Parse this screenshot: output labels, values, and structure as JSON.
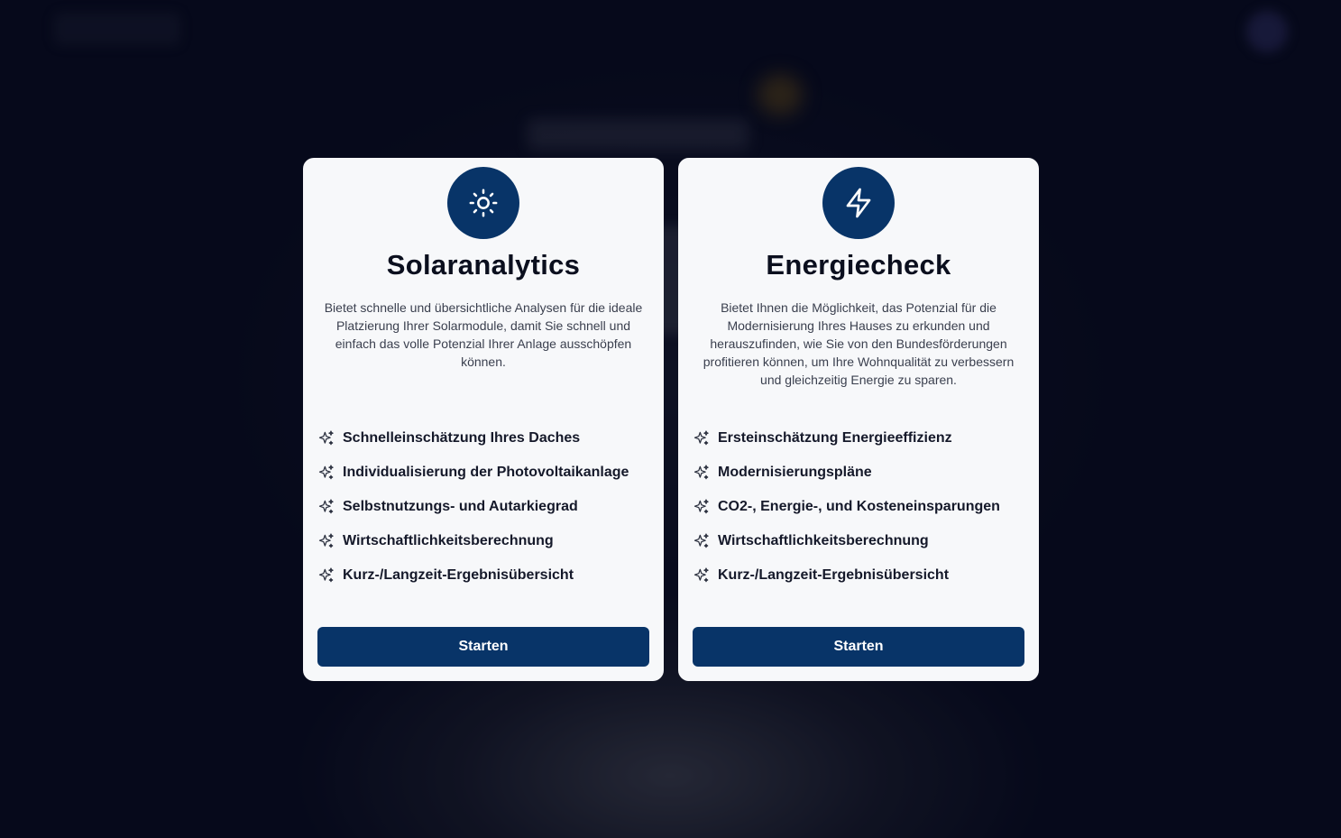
{
  "cards": [
    {
      "icon": "sun-icon",
      "title": "Solaranalytics",
      "description": "Bietet schnelle und übersichtliche Analysen für die ideale Platzierung Ihrer Solarmodule, damit Sie schnell und einfach das volle Potenzial Ihrer Anlage ausschöpfen können.",
      "features": [
        "Schnelleinschätzung Ihres Daches",
        "Individualisierung der Photovoltaikanlage",
        "Selbstnutzungs- und Autarkiegrad",
        "Wirtschaftlichkeitsberechnung",
        "Kurz-/Langzeit-Ergebnisübersicht"
      ],
      "button": "Starten"
    },
    {
      "icon": "lightning-icon",
      "title": "Energiecheck",
      "description": "Bietet Ihnen die Möglichkeit, das Potenzial für die Modernisierung Ihres Hauses zu erkunden und herauszufinden, wie Sie von den Bundesförderungen profitieren können, um Ihre Wohnqualität zu verbessern und gleichzeitig Energie zu sparen.",
      "features": [
        "Ersteinschätzung Energieeffizienz",
        "Modernisierungspläne",
        "CO2-, Energie-, und Kosteneinsparungen",
        "Wirtschaftlichkeitsberechnung",
        "Kurz-/Langzeit-Ergebnisübersicht"
      ],
      "button": "Starten"
    }
  ],
  "colors": {
    "primary": "#083468",
    "card_background": "#f7f8fa",
    "backdrop": "#05081a"
  }
}
